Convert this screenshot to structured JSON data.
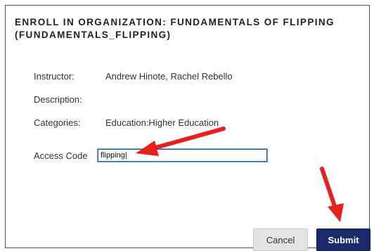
{
  "dialog": {
    "title": "ENROLL IN ORGANIZATION: FUNDAMENTALS OF FLIPPING (FUNDAMENTALS_FLIPPING)"
  },
  "fields": {
    "instructor_label": "Instructor:",
    "instructor_value": "Andrew Hinote, Rachel Rebello",
    "description_label": "Description:",
    "categories_label": "Categories:",
    "categories_value": "Education:Higher Education",
    "access_code_label": "Access Code",
    "access_code_value": "flipping|"
  },
  "buttons": {
    "cancel_label": "Cancel",
    "submit_label": "Submit"
  },
  "annotations": {
    "arrow_color": "#e8211c"
  },
  "colors": {
    "submit_bg": "#1a2b6b",
    "input_focus_border": "#1b5fb3"
  }
}
